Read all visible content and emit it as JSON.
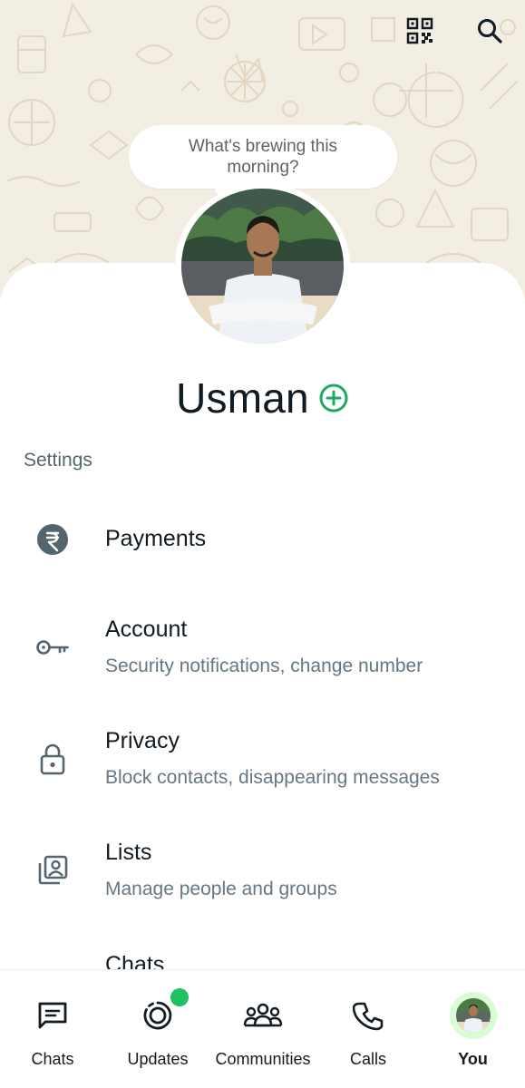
{
  "header": {
    "qr_icon": "qr-code-icon",
    "search_icon": "search-icon",
    "status_prompt": "What's brewing this morning?"
  },
  "profile": {
    "name": "Usman",
    "add_icon": "plus-circle-icon"
  },
  "settings": {
    "title": "Settings",
    "items": [
      {
        "icon": "rupee-icon",
        "title": "Payments",
        "subtitle": ""
      },
      {
        "icon": "key-icon",
        "title": "Account",
        "subtitle": "Security notifications, change number"
      },
      {
        "icon": "lock-icon",
        "title": "Privacy",
        "subtitle": "Block contacts, disappearing messages"
      },
      {
        "icon": "contacts-list-icon",
        "title": "Lists",
        "subtitle": "Manage people and groups"
      },
      {
        "icon": "",
        "title": "Chats",
        "subtitle": ""
      }
    ]
  },
  "nav": {
    "items": [
      {
        "label": "Chats",
        "icon": "chats-icon"
      },
      {
        "label": "Updates",
        "icon": "updates-icon"
      },
      {
        "label": "Communities",
        "icon": "communities-icon"
      },
      {
        "label": "Calls",
        "icon": "phone-icon"
      },
      {
        "label": "You",
        "icon": "avatar"
      }
    ],
    "active": "You"
  },
  "colors": {
    "accent": "#1daa61",
    "badge": "#21c063",
    "header_bg": "#f3eee4",
    "doodle": "#e4d9c6"
  }
}
